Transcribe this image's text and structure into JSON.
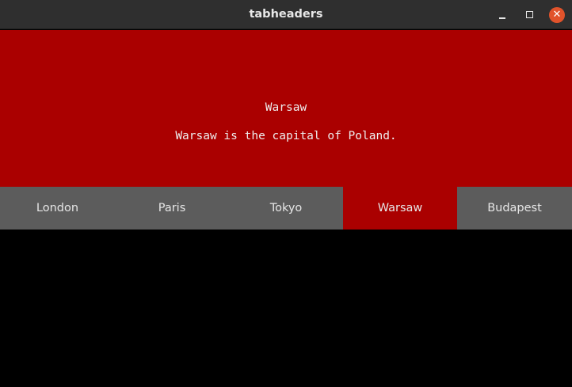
{
  "window": {
    "title": "tabheaders",
    "close_symbol": "✕"
  },
  "colors": {
    "active_tab": "#aa0000",
    "tab_bar": "#5c5c5c",
    "background": "#000000"
  },
  "content": {
    "heading": "Warsaw",
    "body": "Warsaw is the capital of Poland."
  },
  "tabs": [
    {
      "label": "London",
      "active": false
    },
    {
      "label": "Paris",
      "active": false
    },
    {
      "label": "Tokyo",
      "active": false
    },
    {
      "label": "Warsaw",
      "active": true
    },
    {
      "label": "Budapest",
      "active": false
    }
  ]
}
